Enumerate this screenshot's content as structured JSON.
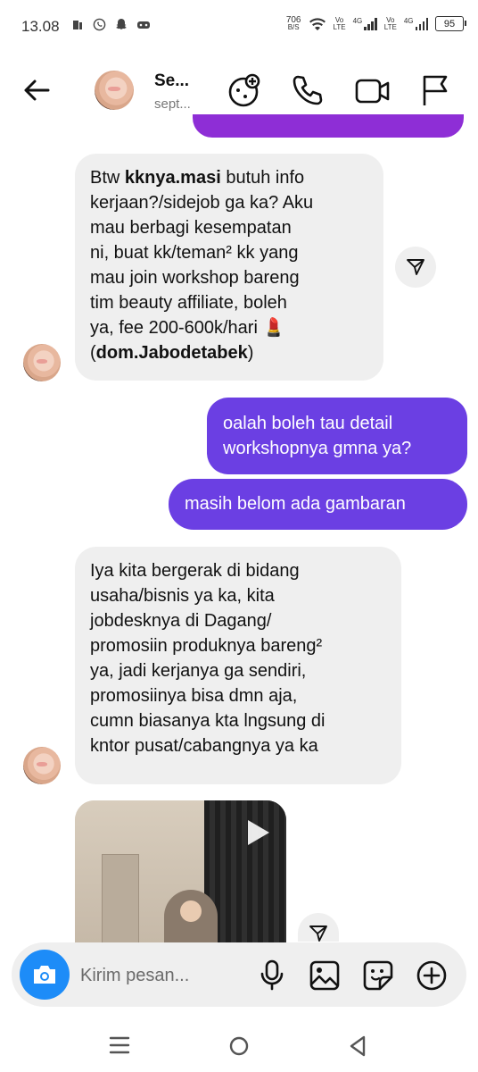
{
  "status_bar": {
    "time": "13.08",
    "network_speed_value": "706",
    "network_speed_unit": "B/S",
    "sim1_label_top": "Vo",
    "sim1_label_bottom": "LTE",
    "sim1_tech": "4G",
    "sim2_label_top": "Vo",
    "sim2_label_bottom": "LTE",
    "sim2_tech": "4G",
    "battery": "95"
  },
  "header": {
    "contact_name": "Se...",
    "contact_subtitle": "sept...",
    "icons": [
      "back-arrow-icon",
      "game-controller-icon",
      "phone-icon",
      "video-camera-icon",
      "flag-icon"
    ]
  },
  "messages": [
    {
      "direction": "incoming",
      "lines": [
        [
          {
            "t": "Btw "
          },
          {
            "t": "kknya.masi",
            "b": true
          },
          {
            "t": " butuh info"
          }
        ],
        [
          {
            "t": "kerjaan?/sidejob ga ka? Aku"
          }
        ],
        [
          {
            "t": "mau berbagi kesempatan"
          }
        ],
        [
          {
            "t": "ni, buat kk/teman² kk yang"
          }
        ],
        [
          {
            "t": "mau join workshop bareng"
          }
        ],
        [
          {
            "t": "tim beauty affiliate, boleh"
          }
        ],
        [
          {
            "t": "ya, fee 200-600k/hari 💄"
          }
        ],
        [
          {
            "t": "("
          },
          {
            "t": "dom.Jabodetabek",
            "b": true
          },
          {
            "t": ")"
          }
        ]
      ]
    },
    {
      "direction": "outgoing",
      "lines": [
        "oalah boleh tau detail",
        "workshopnya gmna ya?"
      ]
    },
    {
      "direction": "outgoing",
      "lines": [
        "masih belom ada gambaran"
      ]
    },
    {
      "direction": "incoming",
      "lines": [
        "Iya kita bergerak di bidang",
        "usaha/bisnis ya ka, kita",
        "jobdesknya di Dagang/",
        "promosiin produknya bareng²",
        "ya, jadi kerjanya ga sendiri,",
        "promosiinya bisa dmn aja,",
        "cumn biasanya kta lngsung di",
        "kntor pusat/cabangnya ya ka"
      ]
    },
    {
      "direction": "incoming",
      "type": "video"
    }
  ],
  "composer": {
    "placeholder": "Kirim pesan...",
    "icons": [
      "camera-icon",
      "microphone-icon",
      "gallery-icon",
      "sticker-icon",
      "plus-icon"
    ]
  },
  "colors": {
    "outgoing_bubble": "#6b3fe3",
    "incoming_bubble": "#efefef",
    "camera_button": "#1d8cf8"
  }
}
